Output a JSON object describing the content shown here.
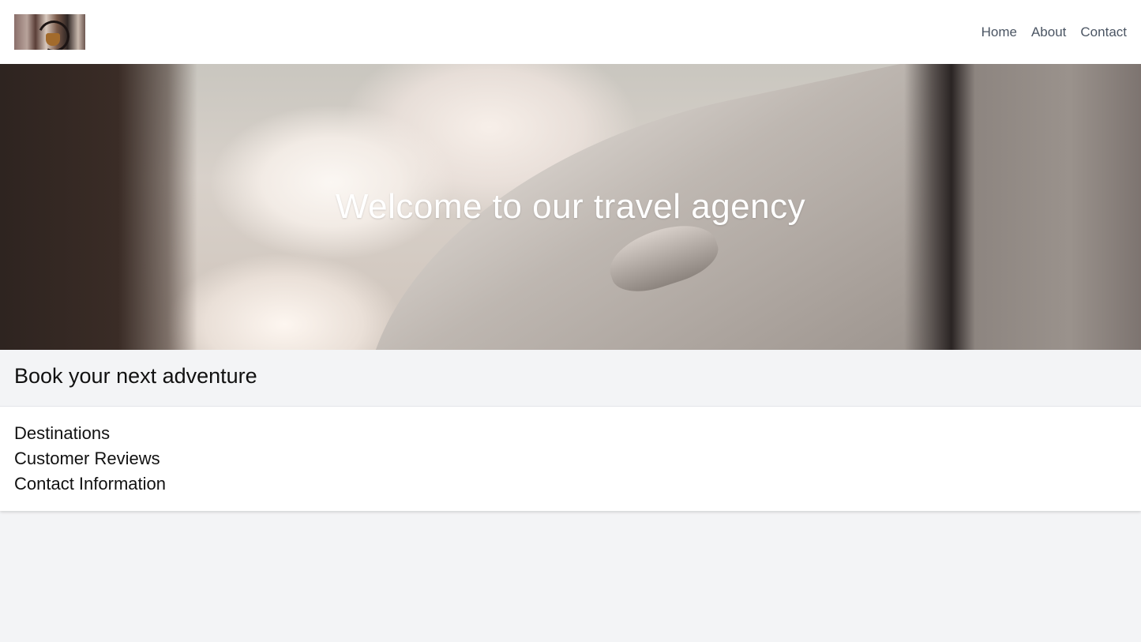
{
  "header": {
    "logo_icon": "travel-agency-logo",
    "nav": [
      {
        "label": "Home"
      },
      {
        "label": "About"
      },
      {
        "label": "Contact"
      }
    ]
  },
  "hero": {
    "title": "Welcome to our travel agency",
    "image": "airplane-window-wing-clouds"
  },
  "booking": {
    "heading": "Book your next adventure"
  },
  "sections": {
    "items": [
      {
        "label": "Destinations"
      },
      {
        "label": "Customer Reviews"
      },
      {
        "label": "Contact Information"
      }
    ]
  }
}
